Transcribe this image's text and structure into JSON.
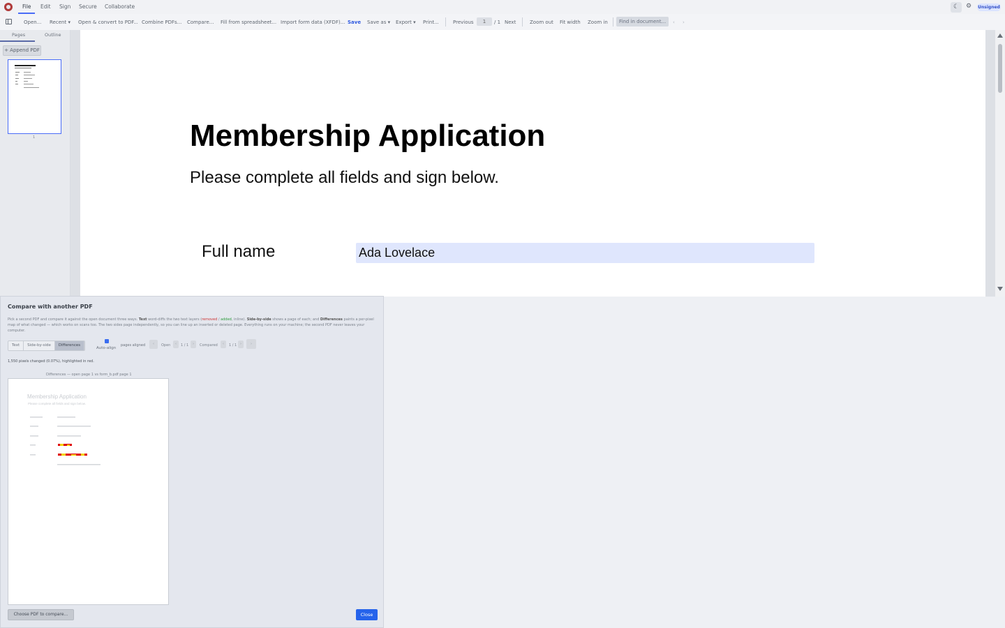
{
  "menubar": {
    "items": [
      "File",
      "Edit",
      "Sign",
      "Secure",
      "Collaborate"
    ],
    "status_badge": "Unsigned"
  },
  "toolbar": {
    "open": "Open...",
    "recent": "Recent",
    "open_convert": "Open & convert to PDF...",
    "combine": "Combine PDFs...",
    "compare": "Compare...",
    "fill_spreadsheet": "Fill from spreadsheet...",
    "import_form": "Import form data (XFDF)...",
    "save": "Save",
    "save_as": "Save as",
    "export": "Export",
    "print": "Print...",
    "previous": "Previous",
    "page_current": "1",
    "page_total": "/ 1",
    "next": "Next",
    "zoom_out": "Zoom out",
    "fit_width": "Fit width",
    "zoom_in": "Zoom in",
    "find_placeholder": "Find in document..."
  },
  "sidebar": {
    "tabs": [
      "Pages",
      "Outline"
    ],
    "append_button": "+ Append PDF",
    "thumb_page_number": "1"
  },
  "document": {
    "title": "Membership Application",
    "subtitle": "Please complete all fields and sign below.",
    "fields": [
      {
        "label": "Full name",
        "value": "Ada Lovelace"
      }
    ]
  },
  "compare_dialog": {
    "title": "Compare with another PDF",
    "desc_start": "Pick a second PDF and compare it against the open document three ways.",
    "desc_text_label": "Text",
    "desc_text_mid": "word-diffs the two text layers (",
    "desc_removed": "removed",
    "desc_slash": "/",
    "desc_added": "added",
    "desc_inline": ", inline).",
    "desc_sbs_label": "Side-by-side",
    "desc_sbs": "shows a page of each; and",
    "desc_diff_label": "Differences",
    "desc_diff": "paints a per-pixel map of what changed — which works on scans too. The two sides page independently, so you can line up an inserted or deleted page. Everything runs on your machine; the second PDF never leaves your computer.",
    "modes": [
      "Text",
      "Side-by-side",
      "Differences"
    ],
    "active_mode": "Differences",
    "auto_align_label": "Auto-align",
    "auto_align_checked": true,
    "pages_aligned": "pages aligned",
    "open_label": "Open",
    "open_pages": "1 / 1",
    "compared_label": "Compared",
    "compared_pages": "1 / 1",
    "status": "1,550 pixels changed (0.07%), highlighted in red.",
    "diff_caption": "Differences — open page 1 vs form_b.pdf page 1",
    "choose_button": "Choose PDF to compare...",
    "close_button": "Close"
  },
  "colors": {
    "accent": "#2563eb",
    "diff_highlight": "#e00000",
    "field_fill": "#dfe6fd"
  }
}
